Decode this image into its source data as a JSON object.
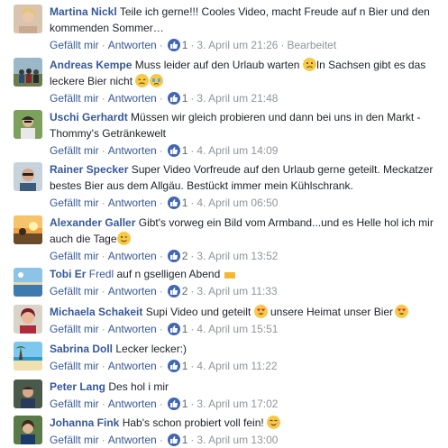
{
  "ui": {
    "like_label": "Gefällt mir",
    "reply_label": "Antworten",
    "separator": "·",
    "edited_label": "Bearbeitet"
  },
  "comments": [
    {
      "author": "Martina Nickl",
      "text": "Teile ich gerne!!! Cooles Video, macht Freude auf n Bier und den kommenden Sommer…",
      "likes": "1",
      "time": "3. April um 21:26",
      "edited": "Bearbeitet"
    },
    {
      "author": "Andreas Kempe",
      "text1": "Muss leider auf den Urlaub warten",
      "text2": "In Sachsen gibt es das leckere Bier nicht",
      "likes": "1",
      "time": "3. April um 21:48"
    },
    {
      "author": "Uschi Gerhardt",
      "text": "Müssen wir gleich probieren und dann bei uns in den Markt - Thommy's Getränkewelt",
      "likes": "1",
      "time": "4. April um 14:09"
    },
    {
      "author": "Rainer Specker",
      "text": "Super Video Vorfreude auf den Urlaub gerne geteilt. Meckatzer bestes Bier aus dem Allgäu. Bestückt immer mein Kühlschrank.",
      "likes": "1",
      "time": "4. April um 06:50"
    },
    {
      "author": "Alexander Galler",
      "text": "Gibt's vorweg ein Bild vom Armband...und es Helle hol ich mir auch die Tage",
      "likes": "2",
      "time": "3. April um 13:52"
    },
    {
      "author": "Tobi Er",
      "mention": "Fredl",
      "text": "auf n gselligen Abend",
      "likes": "2",
      "time": "3. April um 11:33"
    },
    {
      "author": "Michaela Schakeit",
      "text1": "Supi Video und geteilt",
      "text2": "unsere Heimat unser Bier",
      "likes": "1",
      "time": "4. April um 15:51"
    },
    {
      "author": "Sabrina Doll",
      "text": "Lecker lecker:)",
      "likes": "1",
      "time": "4. April um 11:22"
    },
    {
      "author": "Peter Lang",
      "text": "Des hol i mir",
      "likes": "1",
      "time": "3. April um 17:02"
    },
    {
      "author": "Johanna Fink",
      "text": "Hab's schon probiert voll fein!",
      "likes": "1",
      "time": "3. April um 13:00"
    }
  ],
  "colors": {
    "author_link": "#365899",
    "action_link": "#365899",
    "meta": "#90949c",
    "like_badge": "#4267b2",
    "text": "#1d2129"
  }
}
